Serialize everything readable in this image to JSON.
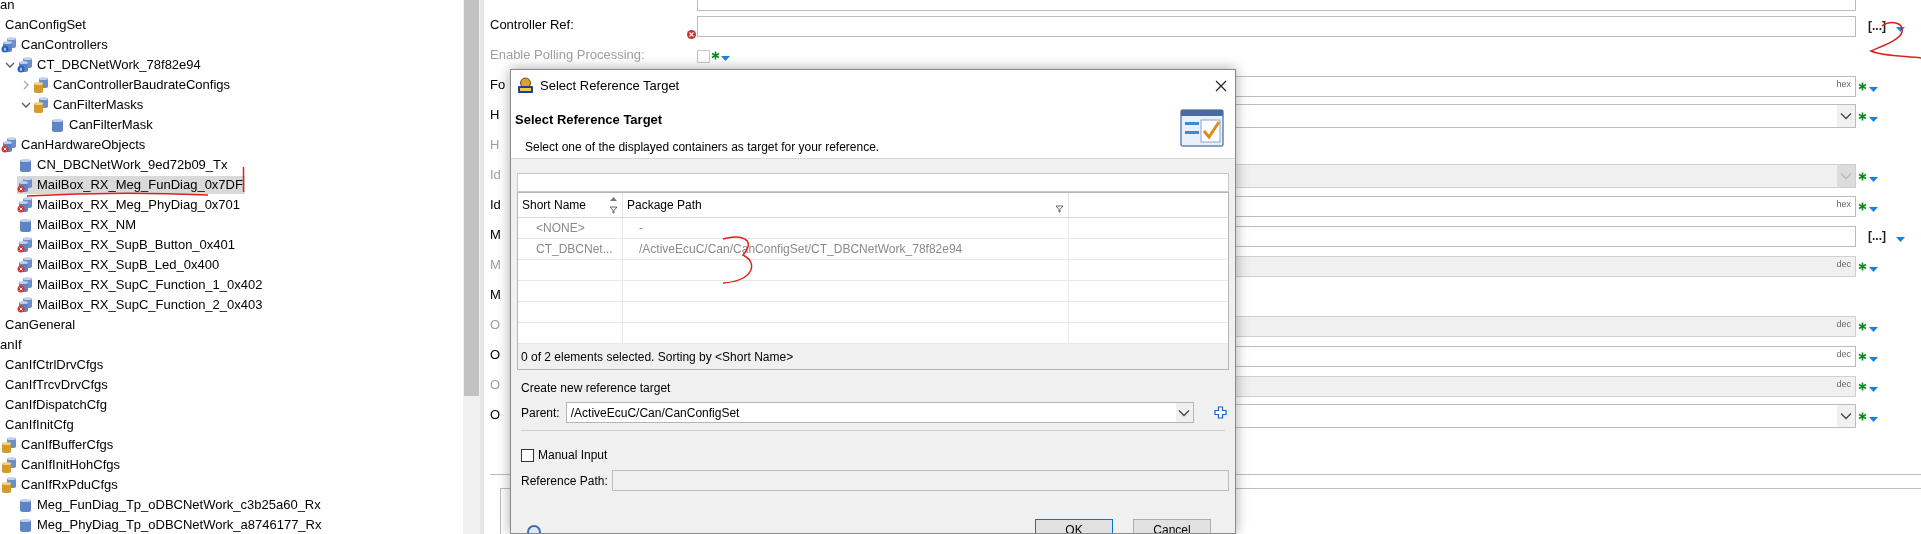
{
  "tree": [
    {
      "label": "an",
      "selected": false,
      "children": [
        {
          "label": "CanConfigSet",
          "selected": false,
          "children": [
            {
              "label": "CanControllers",
              "kind": "module-info",
              "selected": false,
              "children": [
                {
                  "label": "CT_DBCNetWork_78f82e94",
                  "kind": "module-info",
                  "expanded": true,
                  "selected": false,
                  "children": [
                    {
                      "label": "CanControllerBaudrateConfigs",
                      "kind": "folder",
                      "expanded": false,
                      "selected": false
                    },
                    {
                      "label": "CanFilterMasks",
                      "kind": "folder",
                      "expanded": true,
                      "selected": false,
                      "children": [
                        {
                          "label": "CanFilterMask",
                          "kind": "cylinder",
                          "selected": false
                        }
                      ]
                    }
                  ]
                }
              ]
            },
            {
              "label": "CanHardwareObjects",
              "kind": "module-error",
              "selected": false,
              "children": [
                {
                  "label": "CN_DBCNetWork_9ed72b09_Tx",
                  "kind": "cylinder",
                  "selected": false
                },
                {
                  "label": "MailBox_RX_Meg_FunDiag_0x7DF",
                  "kind": "module-error",
                  "selected": true
                },
                {
                  "label": "MailBox_RX_Meg_PhyDiag_0x701",
                  "kind": "module-error",
                  "selected": false
                },
                {
                  "label": "MailBox_RX_NM",
                  "kind": "cylinder",
                  "selected": false
                },
                {
                  "label": "MailBox_RX_SupB_Button_0x401",
                  "kind": "module-error",
                  "selected": false
                },
                {
                  "label": "MailBox_RX_SupB_Led_0x400",
                  "kind": "module-error",
                  "selected": false
                },
                {
                  "label": "MailBox_RX_SupC_Function_1_0x402",
                  "kind": "module-error",
                  "selected": false
                },
                {
                  "label": "MailBox_RX_SupC_Function_2_0x403",
                  "kind": "module-error",
                  "selected": false
                }
              ]
            }
          ]
        },
        {
          "label": "CanGeneral",
          "selected": false
        }
      ]
    },
    {
      "label": "anIf",
      "selected": false,
      "children": [
        {
          "label": "CanIfCtrlDrvCfgs",
          "selected": false
        },
        {
          "label": "CanIfTrcvDrvCfgs",
          "selected": false
        },
        {
          "label": "CanIfDispatchCfg",
          "selected": false
        },
        {
          "label": "CanIfInitCfg",
          "selected": false,
          "children": [
            {
              "label": "CanIfBufferCfgs",
              "kind": "folder",
              "selected": false
            },
            {
              "label": "CanIfInitHohCfgs",
              "kind": "folder",
              "selected": false
            },
            {
              "label": "CanIfRxPduCfgs",
              "kind": "folder",
              "selected": false,
              "children": [
                {
                  "label": "Meg_FunDiag_Tp_oDBCNetWork_c3b25a60_Rx",
                  "kind": "cylinder",
                  "selected": false
                },
                {
                  "label": "Meg_PhyDiag_Tp_oDBCNetWork_a8746177_Rx",
                  "kind": "cylinder",
                  "selected": false
                }
              ]
            }
          ]
        }
      ]
    }
  ],
  "form": {
    "rows": [
      {
        "label": "Controller Ref:",
        "kind": "reference",
        "browse": "[...]",
        "error": true,
        "disabled": false
      },
      {
        "label": "Enable Polling Processing:",
        "kind": "checkbox",
        "checked": false,
        "disabled": true
      },
      {
        "label": "Fo",
        "kind": "text",
        "unit": "hex",
        "disabled": false
      },
      {
        "label": "H",
        "kind": "dropdown",
        "disabled": false
      },
      {
        "label": "H",
        "kind": "label-only",
        "disabled": true
      },
      {
        "label": "Id",
        "kind": "dropdown",
        "disabled": true
      },
      {
        "label": "Id",
        "kind": "text",
        "unit": "hex",
        "disabled": false
      },
      {
        "label": "M",
        "kind": "reference",
        "browse": "[...]",
        "disabled": false
      },
      {
        "label": "M",
        "kind": "text",
        "unit": "dec",
        "disabled": true
      },
      {
        "label": "M",
        "kind": "label-only",
        "disabled": false
      },
      {
        "label": "O",
        "kind": "text",
        "unit": "dec",
        "disabled": true
      },
      {
        "label": "O",
        "kind": "text",
        "unit": "dec",
        "disabled": false
      },
      {
        "label": "O",
        "kind": "text",
        "unit": "dec",
        "disabled": true
      },
      {
        "label": "O",
        "kind": "dropdown",
        "disabled": false
      }
    ]
  },
  "dialog": {
    "title": "Select Reference Target",
    "heading": "Select Reference Target",
    "description": "Select one of the displayed containers as target for your reference.",
    "table": {
      "columns": [
        "Short Name",
        "Package Path"
      ],
      "rows": [
        {
          "cells": [
            "<NONE>",
            "-"
          ],
          "selected": false
        },
        {
          "cells": [
            "CT_DBCNet...",
            "/ActiveEcuC/Can/CanConfigSet/CT_DBCNetWork_78f82e94"
          ],
          "selected": false
        }
      ],
      "status": "0 of 2 elements selected. Sorting by <Short Name>"
    },
    "create_label": "Create new reference target",
    "parent": {
      "label": "Parent:",
      "value": "/ActiveEcuC/Can/CanConfigSet"
    },
    "manual_input": {
      "label": "Manual Input",
      "checked": false
    },
    "reference_path": {
      "label": "Reference Path:",
      "disabled": true
    },
    "buttons": [
      "OK",
      "Cancel"
    ]
  }
}
